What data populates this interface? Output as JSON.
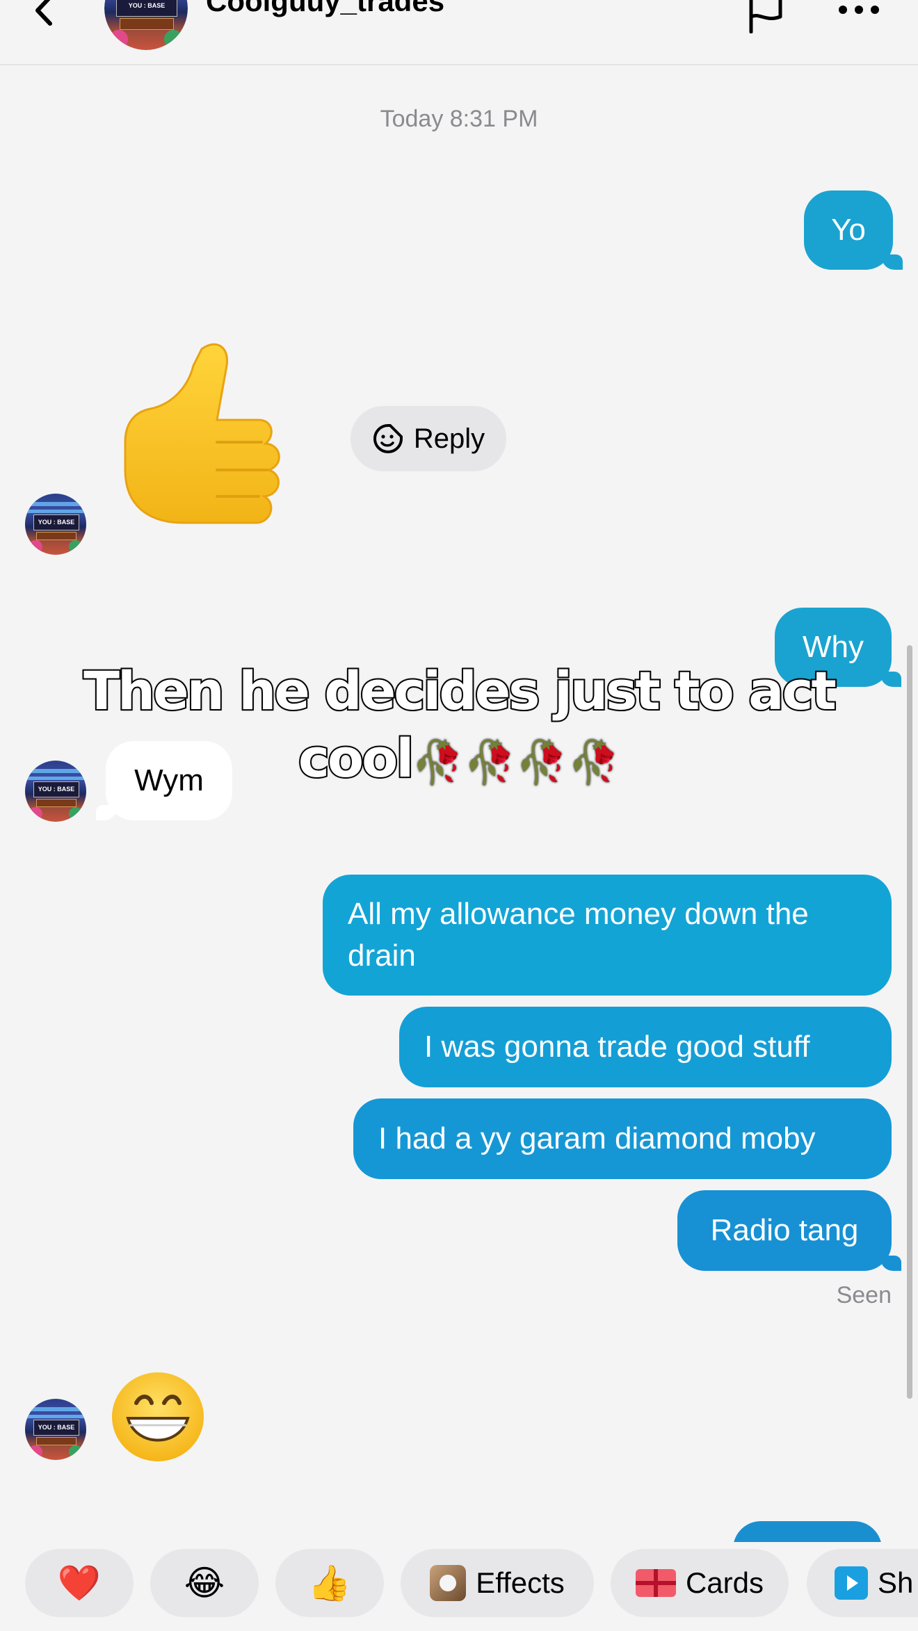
{
  "header": {
    "username": "Coolguuy_trades",
    "avatar_text": "YOU : BASE"
  },
  "chat": {
    "timestamp": "Today 8:31 PM",
    "reply_label": "Reply",
    "seen_label": "Seen",
    "messages": [
      {
        "from": "me",
        "text": "Yo"
      },
      {
        "from": "them",
        "emoji": "thumbs-up"
      },
      {
        "from": "me",
        "text": "Why"
      },
      {
        "from": "them",
        "text": "Wym"
      },
      {
        "from": "me",
        "text": "All my allowance money down the drain"
      },
      {
        "from": "me",
        "text": "I was gonna trade good stuff"
      },
      {
        "from": "me",
        "text": "I had a yy garam diamond moby"
      },
      {
        "from": "me",
        "text": "Radio tang"
      },
      {
        "from": "them",
        "emoji": "grinning-face"
      }
    ]
  },
  "caption": {
    "text": "Then he decides just to act cool",
    "trailing_emoji": "🥀🥀🥀🥀"
  },
  "quick_bar": {
    "heart": "❤️",
    "laugh": "😂",
    "thumbs": "👍",
    "effects_label": "Effects",
    "cards_label": "Cards",
    "share_label": "Sh"
  },
  "colors": {
    "sent_bubble": "#1aa3d0",
    "received_bubble": "#ffffff",
    "background": "#f4f4f5"
  }
}
